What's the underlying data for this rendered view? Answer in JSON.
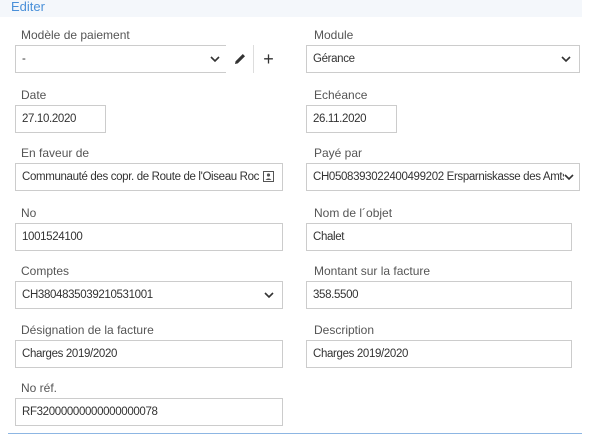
{
  "header": {
    "title": "Editer"
  },
  "form": {
    "payment_model": {
      "label": "Modèle de paiement",
      "value": "-",
      "add_label": "+"
    },
    "module": {
      "label": "Module",
      "value": "Gérance"
    },
    "date": {
      "label": "Date",
      "value": "27.10.2020"
    },
    "due_date": {
      "label": "Echéance",
      "value": "26.11.2020"
    },
    "in_favor_of": {
      "label": "En faveur de",
      "value": "Communauté des copr. de Route de l'Oiseau Roc"
    },
    "paid_by": {
      "label": "Payé par",
      "value": "CH0508393022400499202 Ersparniskasse des Amts"
    },
    "number": {
      "label": "No",
      "value": "1001524100"
    },
    "object_name": {
      "label": "Nom de l´objet",
      "value": "Chalet"
    },
    "accounts": {
      "label": "Comptes",
      "value": "CH3804835039210531001"
    },
    "invoice_amount": {
      "label": "Montant sur la facture",
      "value": "358.5500"
    },
    "invoice_designation": {
      "label": "Désignation de la facture",
      "value": "Charges 2019/2020"
    },
    "description": {
      "label": "Description",
      "value": "Charges 2019/2020"
    },
    "reference": {
      "label": "No réf.",
      "value": "RF32000000000000000078"
    }
  },
  "icons": {
    "chevron": "chevron-down-icon",
    "edit": "pencil-icon",
    "contact": "contact-card-icon"
  }
}
